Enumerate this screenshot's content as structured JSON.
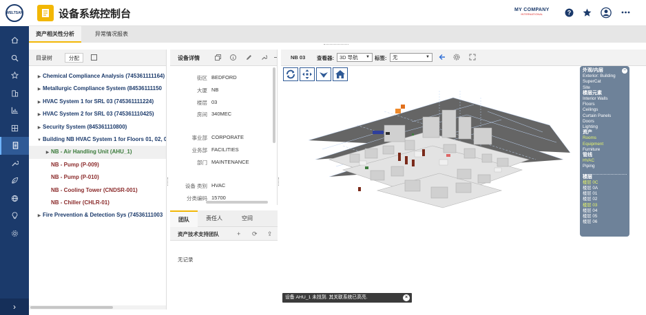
{
  "brand_logo": "WELTSAP",
  "header": {
    "title": "设备系统控制台",
    "company_line1": "MY COMPANY",
    "company_line2": "INTERNATIONAL",
    "accent": "#f2b705"
  },
  "tabs": [
    {
      "label": "资产相关性分析",
      "active": true
    },
    {
      "label": "异常情况报表",
      "active": false
    }
  ],
  "tree": {
    "toolbar_label": "目录树",
    "toolbar_button": "分配",
    "items": [
      {
        "label": "Chemical Compliance Analysis (745361111164)",
        "level": 0
      },
      {
        "label": "Metallurgic Compliance System (84536111150",
        "level": 0
      },
      {
        "label": "HVAC System 1 for SRL 03 (745361111224)",
        "level": 0
      },
      {
        "label": "HVAC System 2 for SRL 03 (745361110425)",
        "level": 0
      },
      {
        "label": "Security System (845361110800)",
        "level": 0
      },
      {
        "label": "Building NB HVAC System 1 for Floors 01, 02, 0",
        "level": 0,
        "expanded": true
      },
      {
        "label": "NB - Air Handling Unit (AHU_1)",
        "level": 1,
        "selected": true
      },
      {
        "label": "NB - Pump (P-009)",
        "level": 1
      },
      {
        "label": "NB - Pump (P-010)",
        "level": 1
      },
      {
        "label": "NB - Cooling Tower (CNDSR-001)",
        "level": 1
      },
      {
        "label": "NB - Chiller (CHLR-01)",
        "level": 1
      },
      {
        "label": "Fire Prevention & Detection Sys (74536111003",
        "level": 0
      }
    ]
  },
  "details": {
    "title": "设备详情",
    "fields": [
      {
        "key": "街区",
        "value": "BEDFORD"
      },
      {
        "key": "大厦",
        "value": "NB"
      },
      {
        "key": "楼层",
        "value": "03"
      },
      {
        "key": "房间",
        "value": "340MEC"
      },
      {
        "key": "事业部",
        "value": "CORPORATE"
      },
      {
        "key": "业务部",
        "value": "FACILITIES"
      },
      {
        "key": "部门",
        "value": "MAINTENANCE"
      },
      {
        "key": "设备 类别",
        "value": "HVAC"
      },
      {
        "key": "分类编码",
        "value": "15700"
      }
    ]
  },
  "team": {
    "tabs": [
      "团队",
      "责任人",
      "空间"
    ],
    "header": "资产技术支持团队",
    "empty": "无记录"
  },
  "viewer": {
    "building": "NB 03",
    "viewer_label": "查看器:",
    "viewer_value": "3D 导航",
    "tag_label": "标签:",
    "tag_value": "无"
  },
  "legend": {
    "sections": [
      {
        "title": "外观/内层",
        "items": [
          {
            "label": "Exterior: Building",
            "on": false
          },
          {
            "label": "SuperCat",
            "on": false
          },
          {
            "label": "Site",
            "on": false
          }
        ]
      },
      {
        "title": "楼层元素",
        "items": [
          {
            "label": "Interior Walls",
            "on": false
          },
          {
            "label": "Floors",
            "on": false
          },
          {
            "label": "Ceilings",
            "on": false
          },
          {
            "label": "Curtain Panels",
            "on": false
          },
          {
            "label": "Doors",
            "on": false
          },
          {
            "label": "Lighting",
            "on": false
          }
        ]
      },
      {
        "title": "资产",
        "items": [
          {
            "label": "Rooms",
            "on": true
          },
          {
            "label": "Equipment",
            "on": true
          },
          {
            "label": "Furniture",
            "on": false
          }
        ]
      },
      {
        "title": "管线",
        "items": [
          {
            "label": "HVAC",
            "on": true
          },
          {
            "label": "Piping",
            "on": false
          }
        ]
      }
    ],
    "floors_title": "楼层",
    "floors": [
      {
        "label": "楼层 0C",
        "on": true
      },
      {
        "label": "楼层 0A",
        "on": false
      },
      {
        "label": "楼层 01",
        "on": false
      },
      {
        "label": "楼层 02",
        "on": false
      },
      {
        "label": "楼层 03",
        "on": true
      },
      {
        "label": "楼层 04",
        "on": false
      },
      {
        "label": "楼层 05",
        "on": false
      },
      {
        "label": "楼层 06",
        "on": false
      }
    ]
  },
  "toast": "设备 AHU_1 未找到. 其关联系统已高亮."
}
